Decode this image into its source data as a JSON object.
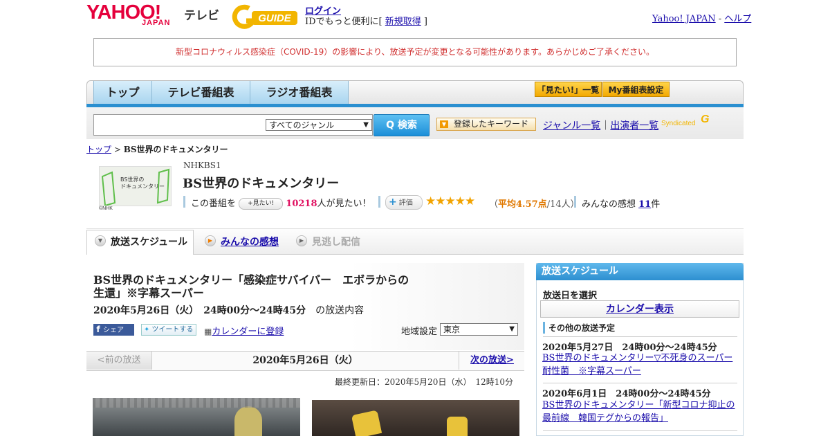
{
  "header": {
    "logo": "YAHOO!",
    "logo_sub": "JAPAN",
    "section": "テレビ",
    "gguide": "G GUIDE",
    "login": "ログイン",
    "id_text": "IDでもっと便利に[ ",
    "signup": "新規取得",
    "id_close": " ]",
    "yahoo_japan": "Yahoo! JAPAN",
    "sep": " - ",
    "help": "ヘルプ"
  },
  "notice": "新型コロナウィルス感染症（COVID-19）の影響により、放送予定が変更となる可能性があります。あらかじめご了承ください。",
  "nav": {
    "tabs": [
      "トップ",
      "テレビ番組表",
      "ラジオ番組表"
    ],
    "mitai_list": "「見たい!」一覧",
    "my_settings": "My番組表設定"
  },
  "search": {
    "genre": "すべてのジャンル",
    "button": "Q 検索",
    "keyword": "登録したキーワード",
    "genre_list": "ジャンル一覧",
    "divider": "｜",
    "cast_list": "出演者一覧",
    "syndicated": "Syndicated"
  },
  "breadcrumb": {
    "top": "トップ",
    "sep": " > ",
    "current": "BS世界のドキュメンタリー"
  },
  "program": {
    "thumb_line1": "BS世界の",
    "thumb_line2": "ドキュメンタリー",
    "copyright": "©NHK",
    "channel": "NHKBS1",
    "title": "BS世界のドキュメンタリー",
    "mitai_prefix": "この番組を",
    "mitai_button": "+見たい!",
    "mitai_count": "10218",
    "mitai_suffix": "人が見たい！",
    "rating_button": "評価",
    "stars": "★★★★★",
    "avg_open": "（",
    "avg_label": "平均4.57点",
    "avg_rest": "/14人）",
    "kanso_prefix": "みんなの感想 ",
    "kanso_count": "11",
    "kanso_suffix": "件"
  },
  "subtabs": {
    "schedule": "放送スケジュール",
    "reviews": "みんなの感想",
    "vod": "見逃し配信"
  },
  "episode": {
    "title": "BS世界のドキュメンタリー「感染症サバイバー　エボラからの生還」※字幕スーパー",
    "datetime": "2020年5月26日（火）　24時00分～24時45分",
    "date_suffix": "　の放送内容",
    "share_fb": "シェア",
    "share_tw": "ツイートする",
    "calendar_register": "カレンダーに登録",
    "region_label": "地域設定",
    "region_value": "東京",
    "prev": "<前の放送",
    "current_date": "2020年5月26日（火）",
    "next": "次の放送>",
    "updated": "最終更新日：2020年5月20日（水）　12時10分"
  },
  "sidebar": {
    "title": "放送スケジュール",
    "select_date": "放送日を選択",
    "calendar_button": "カレンダー表示",
    "other_heading": "その他の放送予定",
    "items": [
      {
        "date": "2020年5月27日　24時00分～24時45分",
        "title": "BS世界のドキュメンタリー▽不死身のスーパー耐性菌　※字幕スーパー"
      },
      {
        "date": "2020年6月1日　24時00分～24時45分",
        "title": "BS世界のドキュメンタリー「新型コロナ抑止の最前線　韓国テグからの報告」"
      }
    ]
  },
  "colors": {
    "brand_red": "#e5003c",
    "accent_blue": "#2a8fd0",
    "star_orange": "#f2a300",
    "notice_red": "#d03030"
  }
}
